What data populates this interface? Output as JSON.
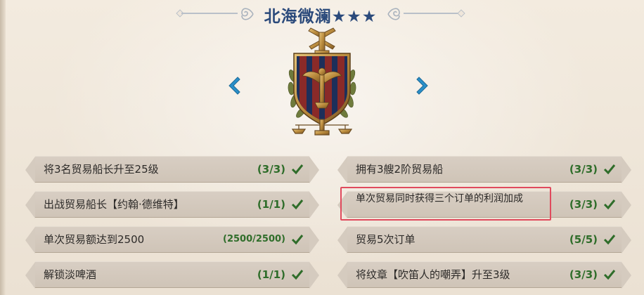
{
  "header": {
    "title": "北海微澜★★★"
  },
  "navigation": {
    "prev_icon": "chevron-left-icon",
    "next_icon": "chevron-right-icon"
  },
  "emblem": {
    "icon": "guild-crest-emblem"
  },
  "colors": {
    "title": "#2b4a7b",
    "progress": "#2f6d2a",
    "highlight": "#e04a5d",
    "row_bg": "#d4c9bd",
    "arrow": "#2a8fc9"
  },
  "tasks": {
    "left": [
      {
        "label": "将3名贸易船长升至25级",
        "progress": "(3/3)",
        "done": true
      },
      {
        "label": "出战贸易船长【约翰·德维特】",
        "progress": "(1/1)",
        "done": true
      },
      {
        "label": "单次贸易额达到2500",
        "progress": "(2500/2500)",
        "done": true
      },
      {
        "label": "解锁淡啤酒",
        "progress": "(1/1)",
        "done": true
      }
    ],
    "right": [
      {
        "label": "拥有3艘2阶贸易船",
        "progress": "(3/3)",
        "done": true
      },
      {
        "label": "单次贸易同时获得三个订单的利润加成",
        "progress": "(3/3)",
        "done": true
      },
      {
        "label": "贸易5次订单",
        "progress": "(5/5)",
        "done": true
      },
      {
        "label": "将纹章【吹笛人的嘲弄】升至3级",
        "progress": "(3/3)",
        "done": true
      }
    ]
  }
}
